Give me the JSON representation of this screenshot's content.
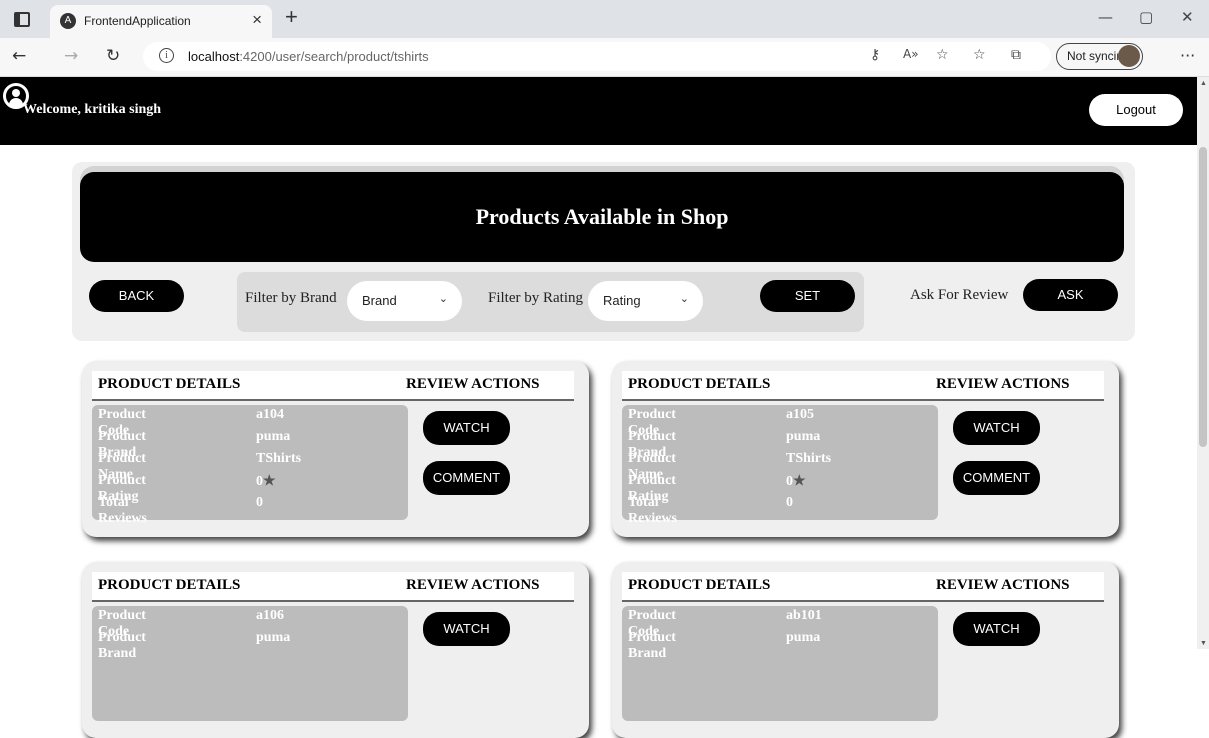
{
  "browser": {
    "tab_title": "FrontendApplication",
    "tab_favicon": "A",
    "tab_close": "×",
    "new_tab": "+",
    "url_host": "localhost",
    "url_path": ":4200/user/search/product/tshirts",
    "sync_label": "Not syncing",
    "back_glyph": "←",
    "forward_glyph": "→",
    "refresh_glyph": "↻",
    "info_glyph": "i",
    "minimize": "—",
    "maximize": "▢",
    "close": "✕",
    "more": "···"
  },
  "app": {
    "welcome": "Welcome, kritika singh",
    "logout_label": "Logout",
    "banner_title": "Products Available in Shop",
    "back_label": "BACK",
    "filter_brand_label": "Filter by Brand",
    "brand_selected": "Brand",
    "filter_rating_label": "Filter by Rating",
    "rating_selected": "Rating",
    "set_label": "SET",
    "ask_review_label": "Ask For Review",
    "ask_label": "ASK"
  },
  "card_labels": {
    "product_details": "PRODUCT DETAILS",
    "review_actions": "REVIEW ACTIONS",
    "product_code": "Product Code",
    "product_brand": "Product Brand",
    "product_name": "Product Name",
    "product_rating": "Product Rating",
    "total_reviews": "Total Reviews",
    "watch": "WATCH",
    "comment": "COMMENT",
    "star": "★"
  },
  "products": [
    {
      "code": "a104",
      "brand": "puma",
      "name": "TShirts",
      "rating": "0",
      "reviews": "0"
    },
    {
      "code": "a105",
      "brand": "puma",
      "name": "TShirts",
      "rating": "0",
      "reviews": "0"
    },
    {
      "code": "a106",
      "brand": "puma"
    },
    {
      "code": "ab101",
      "brand": "puma"
    }
  ]
}
